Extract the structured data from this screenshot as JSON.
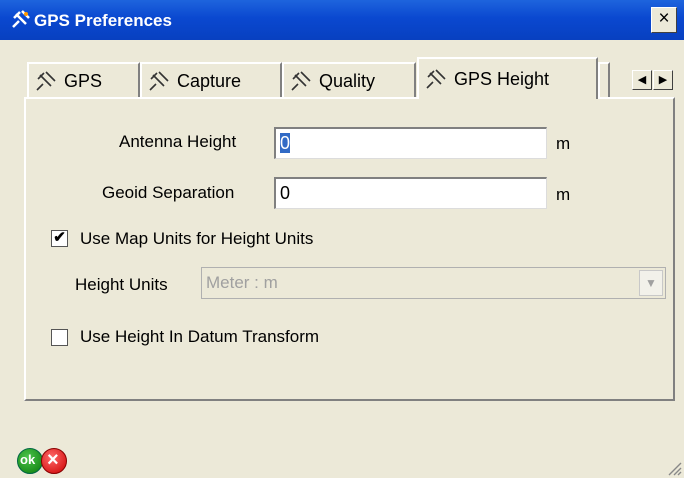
{
  "window": {
    "title": "GPS Preferences",
    "close_label": "×"
  },
  "tabs": [
    {
      "label": "GPS"
    },
    {
      "label": "Capture"
    },
    {
      "label": "Quality"
    },
    {
      "label": "GPS Height",
      "active": true
    }
  ],
  "tab_scroll": {
    "left": "◀",
    "right": "▶"
  },
  "form": {
    "antenna_height_label": "Antenna Height",
    "antenna_height_value": "0",
    "antenna_height_unit": "m",
    "geoid_separation_label": "Geoid Separation",
    "geoid_separation_value": "0",
    "geoid_separation_unit": "m",
    "use_map_units_label": "Use Map Units for Height Units",
    "use_map_units_checked": true,
    "use_map_units_mark": "✔",
    "height_units_label": "Height Units",
    "height_units_value": "Meter : m",
    "height_units_arrow": "▼",
    "use_height_datum_label": "Use Height In Datum Transform",
    "use_height_datum_checked": false
  },
  "footer": {
    "ok_label": "ok",
    "cancel_label": "×"
  }
}
